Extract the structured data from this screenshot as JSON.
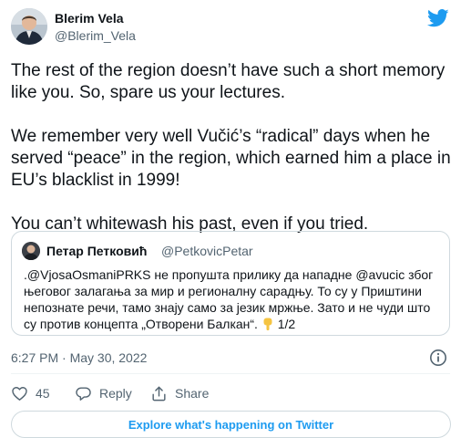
{
  "author": {
    "name": "Blerim Vela",
    "handle": "@Blerim_Vela"
  },
  "tweet": {
    "paragraphs": [
      "The rest of the region doesn’t have such a short memory like you. So, spare us your lectures.",
      "We remember very well Vučić’s “radical” days when he served “peace” in the region, which earned him a place in EU’s blacklist in 1999!",
      "You can’t whitewash his past, even if you tried."
    ]
  },
  "quoted": {
    "name": "Петар Петковић",
    "handle": "@PetkovicPetar",
    "text": ".@VjosaOsmaniPRKS не пропушта прилику да нападне @avucic због његовог залагања за мир и регионалну сарадњу. То су у Приштини непознате речи, тамо знају само за језик мржње. Зато и не чуди што су против концепта „Отворени Балкан“.",
    "text_suffix": "1/2"
  },
  "meta": {
    "timestamp": "6:27 PM · May 30, 2022"
  },
  "actions": {
    "like_count": "45",
    "reply_label": "Reply",
    "share_label": "Share"
  },
  "footer": {
    "explore_label": "Explore what's happening on Twitter"
  },
  "icons": {
    "logo": "twitter-bird-icon",
    "info": "info-icon",
    "like": "heart-icon",
    "reply": "speech-bubble-icon",
    "share": "share-icon",
    "emoji": "pointing-down-hand-emoji"
  },
  "colors": {
    "accent": "#1d9bf0",
    "text": "#0f1419",
    "secondary": "#536471",
    "border": "#cfd9de"
  }
}
